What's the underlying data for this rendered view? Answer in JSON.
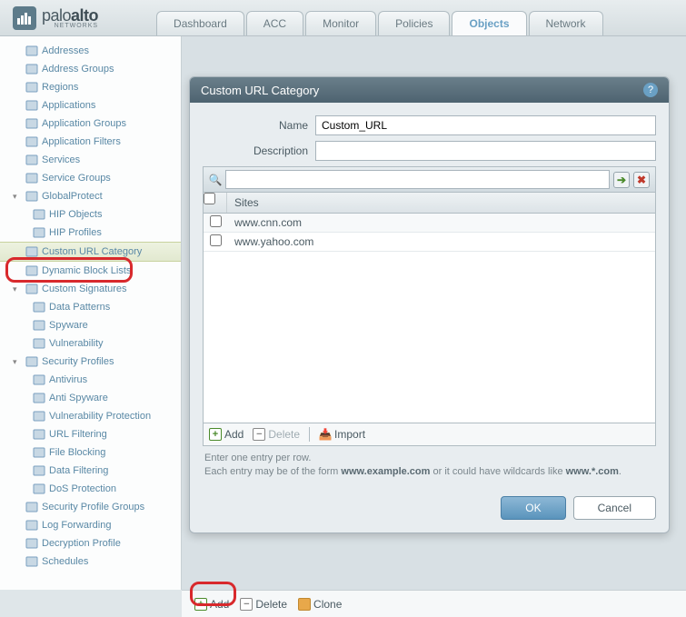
{
  "brand": {
    "name1": "palo",
    "name2": "alto",
    "sub": "NETWORKS"
  },
  "tabs": [
    {
      "label": "Dashboard"
    },
    {
      "label": "ACC"
    },
    {
      "label": "Monitor"
    },
    {
      "label": "Policies"
    },
    {
      "label": "Objects",
      "active": true
    },
    {
      "label": "Network"
    }
  ],
  "tree": [
    {
      "label": "Addresses",
      "icon": "addresses"
    },
    {
      "label": "Address Groups",
      "icon": "address-groups"
    },
    {
      "label": "Regions",
      "icon": "regions"
    },
    {
      "label": "Applications",
      "icon": "applications"
    },
    {
      "label": "Application Groups",
      "icon": "application-groups"
    },
    {
      "label": "Application Filters",
      "icon": "application-filters"
    },
    {
      "label": "Services",
      "icon": "services"
    },
    {
      "label": "Service Groups",
      "icon": "service-groups"
    },
    {
      "label": "GlobalProtect",
      "icon": "globalprotect",
      "expanded": true,
      "children": [
        {
          "label": "HIP Objects",
          "icon": "hip-objects"
        },
        {
          "label": "HIP Profiles",
          "icon": "hip-profiles"
        }
      ]
    },
    {
      "label": "Custom URL Category",
      "icon": "custom-url",
      "selected": true
    },
    {
      "label": "Dynamic Block Lists",
      "icon": "dynamic-block"
    },
    {
      "label": "Custom Signatures",
      "icon": "custom-sig",
      "expanded": true,
      "children": [
        {
          "label": "Data Patterns",
          "icon": "data-patterns"
        },
        {
          "label": "Spyware",
          "icon": "spyware"
        },
        {
          "label": "Vulnerability",
          "icon": "vulnerability"
        }
      ]
    },
    {
      "label": "Security Profiles",
      "icon": "sec-profiles",
      "expanded": true,
      "children": [
        {
          "label": "Antivirus",
          "icon": "antivirus"
        },
        {
          "label": "Anti Spyware",
          "icon": "anti-spyware"
        },
        {
          "label": "Vulnerability Protection",
          "icon": "vuln-protect"
        },
        {
          "label": "URL Filtering",
          "icon": "url-filter"
        },
        {
          "label": "File Blocking",
          "icon": "file-block"
        },
        {
          "label": "Data Filtering",
          "icon": "data-filter"
        },
        {
          "label": "DoS Protection",
          "icon": "dos"
        }
      ]
    },
    {
      "label": "Security Profile Groups",
      "icon": "sec-profile-groups"
    },
    {
      "label": "Log Forwarding",
      "icon": "log-fwd"
    },
    {
      "label": "Decryption Profile",
      "icon": "decrypt"
    },
    {
      "label": "Schedules",
      "icon": "schedules"
    }
  ],
  "dialog": {
    "title": "Custom URL Category",
    "fields": {
      "name_label": "Name",
      "name_value": "Custom_URL",
      "desc_label": "Description",
      "desc_value": ""
    },
    "grid": {
      "header": "Sites",
      "rows": [
        "www.cnn.com",
        "www.yahoo.com"
      ]
    },
    "actions": {
      "add": "Add",
      "delete": "Delete",
      "import": "Import"
    },
    "hint_line1": "Enter one entry per row.",
    "hint_pre": "Each entry may be of the form ",
    "hint_ex1": "www.example.com",
    "hint_mid": " or it could have wildcards like ",
    "hint_ex2": "www.*.com",
    "hint_end": ".",
    "buttons": {
      "ok": "OK",
      "cancel": "Cancel"
    }
  },
  "bottom": {
    "add": "Add",
    "delete": "Delete",
    "clone": "Clone"
  }
}
